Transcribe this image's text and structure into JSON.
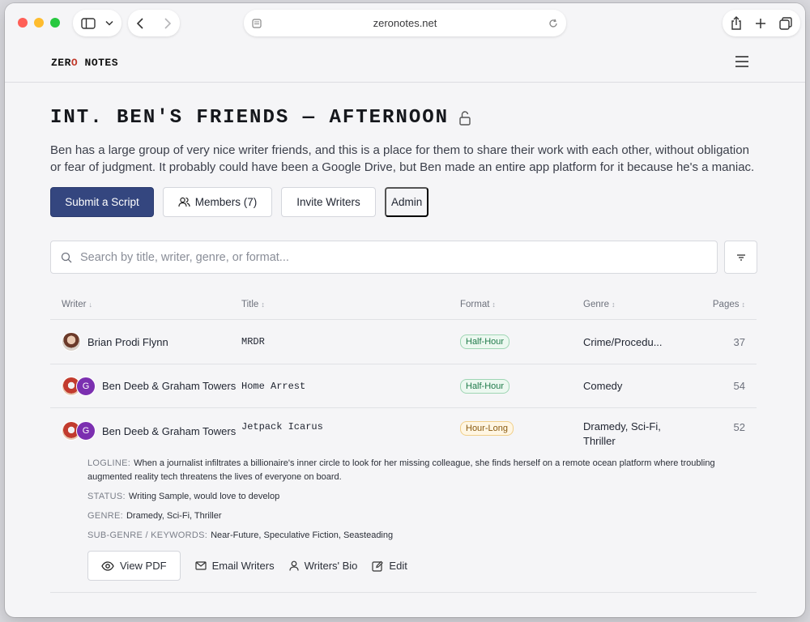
{
  "browser": {
    "url": "zeronotes.net",
    "colors": {
      "close": "#ff5f57",
      "minimize": "#febc2e",
      "zoom": "#28c840"
    }
  },
  "app": {
    "logo": {
      "part1": "ZER",
      "part2": "O",
      "part3": " NOTES"
    }
  },
  "group": {
    "title": "INT. BEN'S FRIENDS — AFTERNOON",
    "description": "Ben has a large group of very nice writer friends, and this is a place for them to share their work with each other, without obligation or fear of judgment. It probably could have been a Google Drive, but Ben made an entire app platform for it because he's a maniac."
  },
  "actions": {
    "submit": "Submit a Script",
    "members": "Members (7)",
    "invite": "Invite Writers",
    "admin": "Admin"
  },
  "search": {
    "placeholder": "Search by title, writer, genre, or format..."
  },
  "table": {
    "headers": {
      "writer": "Writer",
      "title": "Title",
      "format": "Format",
      "genre": "Genre",
      "pages": "Pages"
    },
    "rows": [
      {
        "writer": "Brian Prodi Flynn",
        "title": "MRDR",
        "format": "Half-Hour",
        "genre": "Crime/Procedu...",
        "pages": "37"
      },
      {
        "writer": "Ben Deeb & Graham Towers",
        "avatar_letter": "G",
        "title": "Home Arrest",
        "format": "Half-Hour",
        "genre": "Comedy",
        "pages": "54"
      },
      {
        "writer": "Ben Deeb & Graham Towers",
        "avatar_letter": "G",
        "title": "Jetpack Icarus",
        "format": "Hour-Long",
        "genre_line1": "Dramedy, Sci-Fi,",
        "genre_line2": "Thriller",
        "pages": "52"
      }
    ]
  },
  "expanded": {
    "logline_label": "LOGLINE:",
    "logline": "When a journalist infiltrates a billionaire's inner circle to look for her missing colleague, she finds herself on a remote ocean platform where troubling augmented reality tech threatens the lives of everyone on board.",
    "status_label": "STATUS:",
    "status": "Writing Sample, would love to develop",
    "genre_label": "GENRE:",
    "genre": "Dramedy, Sci-Fi, Thriller",
    "subgenre_label": "SUB-GENRE / KEYWORDS:",
    "subgenre": "Near-Future, Speculative Fiction, Seasteading",
    "view_pdf": "View PDF",
    "email": "Email Writers",
    "bio": "Writers' Bio",
    "edit": "Edit"
  }
}
